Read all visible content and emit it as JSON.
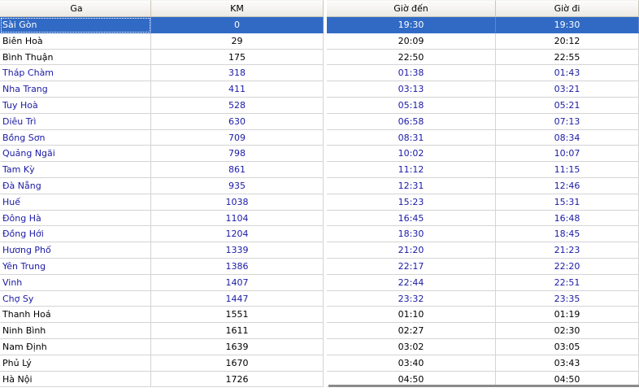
{
  "headers": {
    "ga": "Ga",
    "km": "KM",
    "gio_den": "Giờ đến",
    "gio_di": "Giờ đi"
  },
  "colors": {
    "selection": "#316ac5",
    "link_text": "#1a1aa6",
    "grid": "#d4d4d4"
  },
  "rows": [
    {
      "ga": "Sài Gòn",
      "km": "0",
      "gio_den": "19:30",
      "gio_di": "19:30"
    },
    {
      "ga": "Biên Hoà",
      "km": "29",
      "gio_den": "20:09",
      "gio_di": "20:12"
    },
    {
      "ga": "Bình Thuận",
      "km": "175",
      "gio_den": "22:50",
      "gio_di": "22:55"
    },
    {
      "ga": "Tháp Chàm",
      "km": "318",
      "gio_den": "01:38",
      "gio_di": "01:43"
    },
    {
      "ga": "Nha Trang",
      "km": "411",
      "gio_den": "03:13",
      "gio_di": "03:21"
    },
    {
      "ga": "Tuy Hoà",
      "km": "528",
      "gio_den": "05:18",
      "gio_di": "05:21"
    },
    {
      "ga": "Diêu Trì",
      "km": "630",
      "gio_den": "06:58",
      "gio_di": "07:13"
    },
    {
      "ga": "Bồng Sơn",
      "km": "709",
      "gio_den": "08:31",
      "gio_di": "08:34"
    },
    {
      "ga": "Quảng Ngãi",
      "km": "798",
      "gio_den": "10:02",
      "gio_di": "10:07"
    },
    {
      "ga": "Tam Kỳ",
      "km": "861",
      "gio_den": "11:12",
      "gio_di": "11:15"
    },
    {
      "ga": "Đà Nẵng",
      "km": "935",
      "gio_den": "12:31",
      "gio_di": "12:46"
    },
    {
      "ga": "Huế",
      "km": "1038",
      "gio_den": "15:23",
      "gio_di": "15:31"
    },
    {
      "ga": "Đông Hà",
      "km": "1104",
      "gio_den": "16:45",
      "gio_di": "16:48"
    },
    {
      "ga": "Đồng Hới",
      "km": "1204",
      "gio_den": "18:30",
      "gio_di": "18:45"
    },
    {
      "ga": "Hương Phố",
      "km": "1339",
      "gio_den": "21:20",
      "gio_di": "21:23"
    },
    {
      "ga": "Yên Trung",
      "km": "1386",
      "gio_den": "22:17",
      "gio_di": "22:20"
    },
    {
      "ga": "Vinh",
      "km": "1407",
      "gio_den": "22:44",
      "gio_di": "22:51"
    },
    {
      "ga": "Chợ Sy",
      "km": "1447",
      "gio_den": "23:32",
      "gio_di": "23:35"
    },
    {
      "ga": "Thanh Hoá",
      "km": "1551",
      "gio_den": "01:10",
      "gio_di": "01:19"
    },
    {
      "ga": "Ninh Bình",
      "km": "1611",
      "gio_den": "02:27",
      "gio_di": "02:30"
    },
    {
      "ga": "Nam Định",
      "km": "1639",
      "gio_den": "03:02",
      "gio_di": "03:05"
    },
    {
      "ga": "Phủ Lý",
      "km": "1670",
      "gio_den": "03:40",
      "gio_di": "03:43"
    },
    {
      "ga": "Hà Nội",
      "km": "1726",
      "gio_den": "04:50",
      "gio_di": "04:50"
    }
  ]
}
